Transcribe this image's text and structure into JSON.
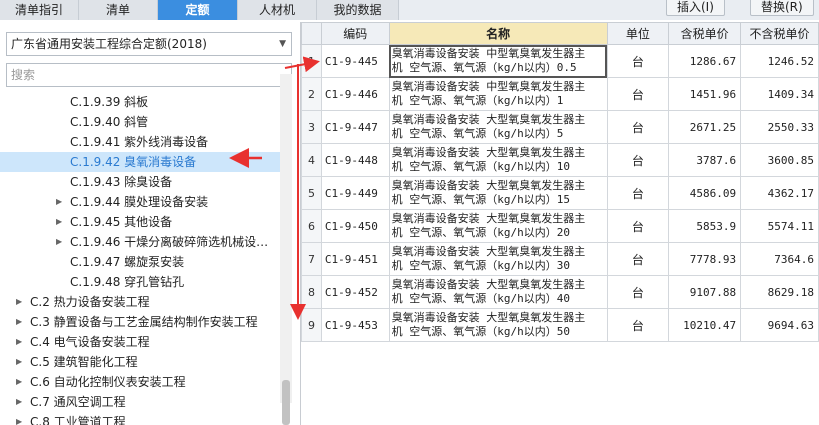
{
  "tabs": [
    {
      "label": "清单指引",
      "active": false
    },
    {
      "label": "清单",
      "active": false
    },
    {
      "label": "定额",
      "active": true
    },
    {
      "label": "人材机",
      "active": false
    },
    {
      "label": "我的数据",
      "active": false
    }
  ],
  "toolbar": {
    "insert_label": "插入(I)",
    "replace_label": "替换(R)"
  },
  "library_select": {
    "value": "广东省通用安装工程综合定额(2018)"
  },
  "search": {
    "placeholder": "搜索"
  },
  "tree": [
    {
      "label": "C.1.9.39 斜板",
      "expandable": false,
      "selected": false
    },
    {
      "label": "C.1.9.40 斜管",
      "expandable": false,
      "selected": false
    },
    {
      "label": "C.1.9.41 紫外线消毒设备",
      "expandable": false,
      "selected": false
    },
    {
      "label": "C.1.9.42 臭氧消毒设备",
      "expandable": false,
      "selected": true
    },
    {
      "label": "C.1.9.43 除臭设备",
      "expandable": false,
      "selected": false
    },
    {
      "label": "C.1.9.44 膜处理设备安装",
      "expandable": true,
      "selected": false
    },
    {
      "label": "C.1.9.45 其他设备",
      "expandable": true,
      "selected": false
    },
    {
      "label": "C.1.9.46 干燥分离破碎筛选机械设…",
      "expandable": true,
      "selected": false
    },
    {
      "label": "C.1.9.47 螺旋泵安装",
      "expandable": false,
      "selected": false
    },
    {
      "label": "C.1.9.48 穿孔管钻孔",
      "expandable": false,
      "selected": false
    },
    {
      "label": "C.2 热力设备安装工程",
      "expandable": true,
      "selected": false
    },
    {
      "label": "C.3 静置设备与工艺金属结构制作安装工程",
      "expandable": true,
      "selected": false
    },
    {
      "label": "C.4 电气设备安装工程",
      "expandable": true,
      "selected": false
    },
    {
      "label": "C.5 建筑智能化工程",
      "expandable": true,
      "selected": false
    },
    {
      "label": "C.6 自动化控制仪表安装工程",
      "expandable": true,
      "selected": false
    },
    {
      "label": "C.7 通风空调工程",
      "expandable": true,
      "selected": false
    },
    {
      "label": "C.8 工业管道工程",
      "expandable": true,
      "selected": false
    }
  ],
  "table": {
    "headers": {
      "idx": "",
      "code": "编码",
      "name": "名称",
      "unit": "单位",
      "tax_price": "含税单价",
      "notax_price": "不含税单价"
    },
    "rows": [
      {
        "idx": "1",
        "code": "C1-9-445",
        "name1": "臭氧消毒设备安装 中型氧臭氧发生器主",
        "name2": "机 空气源、氧气源（kg/h以内）0.5",
        "unit": "台",
        "tax": "1286.67",
        "notax": "1246.52"
      },
      {
        "idx": "2",
        "code": "C1-9-446",
        "name1": "臭氧消毒设备安装 中型氧臭氧发生器主",
        "name2": "机 空气源、氧气源（kg/h以内）1",
        "unit": "台",
        "tax": "1451.96",
        "notax": "1409.34"
      },
      {
        "idx": "3",
        "code": "C1-9-447",
        "name1": "臭氧消毒设备安装 大型氧臭氧发生器主",
        "name2": "机 空气源、氧气源（kg/h以内）5",
        "unit": "台",
        "tax": "2671.25",
        "notax": "2550.33"
      },
      {
        "idx": "4",
        "code": "C1-9-448",
        "name1": "臭氧消毒设备安装 大型氧臭氧发生器主",
        "name2": "机 空气源、氧气源（kg/h以内）10",
        "unit": "台",
        "tax": "3787.6",
        "notax": "3600.85"
      },
      {
        "idx": "5",
        "code": "C1-9-449",
        "name1": "臭氧消毒设备安装 大型氧臭氧发生器主",
        "name2": "机 空气源、氧气源（kg/h以内）15",
        "unit": "台",
        "tax": "4586.09",
        "notax": "4362.17"
      },
      {
        "idx": "6",
        "code": "C1-9-450",
        "name1": "臭氧消毒设备安装 大型氧臭氧发生器主",
        "name2": "机 空气源、氧气源（kg/h以内）20",
        "unit": "台",
        "tax": "5853.9",
        "notax": "5574.11"
      },
      {
        "idx": "7",
        "code": "C1-9-451",
        "name1": "臭氧消毒设备安装 大型氧臭氧发生器主",
        "name2": "机 空气源、氧气源（kg/h以内）30",
        "unit": "台",
        "tax": "7778.93",
        "notax": "7364.6"
      },
      {
        "idx": "8",
        "code": "C1-9-452",
        "name1": "臭氧消毒设备安装 大型氧臭氧发生器主",
        "name2": "机 空气源、氧气源（kg/h以内）40",
        "unit": "台",
        "tax": "9107.88",
        "notax": "8629.18"
      },
      {
        "idx": "9",
        "code": "C1-9-453",
        "name1": "臭氧消毒设备安装 大型氧臭氧发生器主",
        "name2": "机 空气源、氧气源（kg/h以内）50",
        "unit": "台",
        "tax": "10210.47",
        "notax": "9694.63"
      }
    ]
  },
  "colors": {
    "accent": "#3b8ee0",
    "selected_bg": "#cde6fb",
    "annotation_red": "#e8312f"
  }
}
